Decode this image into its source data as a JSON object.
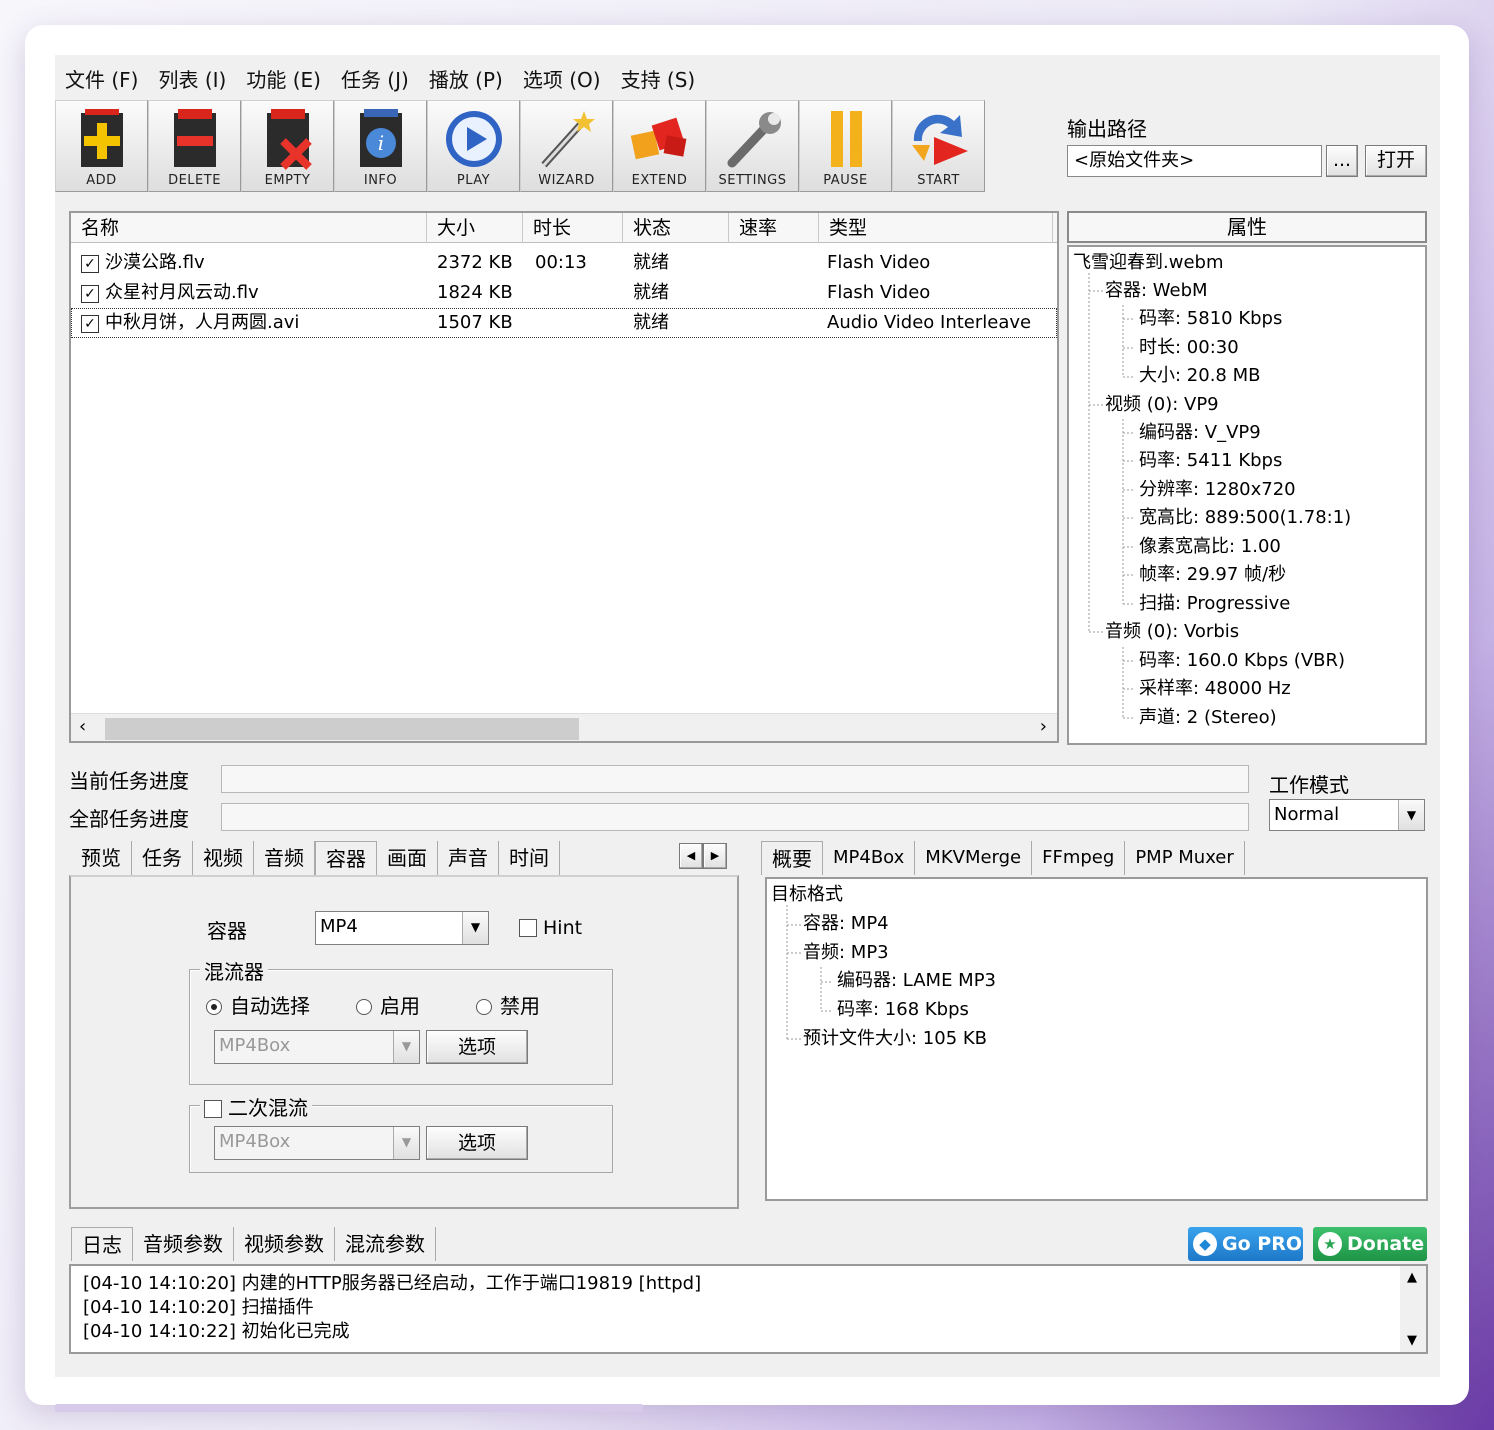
{
  "menu": [
    "文件 (F)",
    "列表 (I)",
    "功能 (E)",
    "任务 (J)",
    "播放 (P)",
    "选项 (O)",
    "支持 (S)"
  ],
  "toolbar": {
    "buttons": [
      {
        "label": "ADD",
        "icon": "add-icon"
      },
      {
        "label": "DELETE",
        "icon": "delete-icon"
      },
      {
        "label": "EMPTY",
        "icon": "empty-icon"
      },
      {
        "label": "INFO",
        "icon": "info-icon"
      },
      {
        "label": "PLAY",
        "icon": "play-icon"
      },
      {
        "label": "WIZARD",
        "icon": "wizard-icon"
      },
      {
        "label": "EXTEND",
        "icon": "extend-icon"
      },
      {
        "label": "SETTINGS",
        "icon": "settings-icon"
      },
      {
        "label": "PAUSE",
        "icon": "pause-icon"
      },
      {
        "label": "START",
        "icon": "start-icon"
      }
    ]
  },
  "output": {
    "label": "输出路径",
    "value": "<原始文件夹>",
    "browse": "...",
    "open": "打开"
  },
  "file_list": {
    "columns": [
      "名称",
      "大小",
      "时长",
      "状态",
      "速率",
      "类型"
    ],
    "rows": [
      {
        "checked": true,
        "name": "沙漠公路.flv",
        "size": "2372 KB",
        "duration": "00:13",
        "status": "就绪",
        "rate": "",
        "type": "Flash Video"
      },
      {
        "checked": true,
        "name": "众星衬月风云动.flv",
        "size": "1824 KB",
        "duration": "",
        "status": "就绪",
        "rate": "",
        "type": "Flash Video"
      },
      {
        "checked": true,
        "name": "中秋月饼，人月两圆.avi",
        "size": "1507 KB",
        "duration": "",
        "status": "就绪",
        "rate": "",
        "type": "Audio Video Interleave"
      }
    ]
  },
  "properties": {
    "header": "属性",
    "tree": [
      {
        "text": "飞雪迎春到.webm",
        "level": 0
      },
      {
        "text": "容器: WebM",
        "level": 1
      },
      {
        "text": "码率: 5810 Kbps",
        "level": 2
      },
      {
        "text": "时长: 00:30",
        "level": 2
      },
      {
        "text": "大小: 20.8 MB",
        "level": 2
      },
      {
        "text": "视频 (0): VP9",
        "level": 1
      },
      {
        "text": "编码器: V_VP9",
        "level": 2
      },
      {
        "text": "码率: 5411 Kbps",
        "level": 2
      },
      {
        "text": "分辨率: 1280x720",
        "level": 2
      },
      {
        "text": "宽高比: 889:500(1.78:1)",
        "level": 2
      },
      {
        "text": "像素宽高比: 1.00",
        "level": 2
      },
      {
        "text": "帧率: 29.97 帧/秒",
        "level": 2
      },
      {
        "text": "扫描: Progressive",
        "level": 2
      },
      {
        "text": "音频 (0): Vorbis",
        "level": 1
      },
      {
        "text": "码率: 160.0 Kbps (VBR)",
        "level": 2
      },
      {
        "text": "采样率: 48000 Hz",
        "level": 2
      },
      {
        "text": "声道: 2 (Stereo)",
        "level": 2
      }
    ]
  },
  "progress": {
    "current_label": "当前任务进度",
    "total_label": "全部任务进度",
    "current_value": 0,
    "total_value": 0
  },
  "work_mode": {
    "label": "工作模式",
    "value": "Normal"
  },
  "left_tabs": [
    "预览",
    "任务",
    "视频",
    "音频",
    "容器",
    "画面",
    "声音",
    "时间"
  ],
  "container_panel": {
    "container_label": "容器",
    "container_value": "MP4",
    "hint_label": "Hint",
    "muxer_legend": "混流器",
    "radio_auto": "自动选择",
    "radio_enable": "启用",
    "radio_disable": "禁用",
    "muxer_value": "MP4Box",
    "options_label": "选项",
    "remux_legend": "二次混流",
    "remux_value": "MP4Box",
    "remux_options_label": "选项"
  },
  "right_tabs": [
    "概要",
    "MP4Box",
    "MKVMerge",
    "FFmpeg",
    "PMP Muxer"
  ],
  "summary_tree": [
    {
      "text": "目标格式",
      "level": 0
    },
    {
      "text": "容器: MP4",
      "level": 1
    },
    {
      "text": "音频: MP3",
      "level": 1
    },
    {
      "text": "编码器: LAME MP3",
      "level": 2
    },
    {
      "text": "码率: 168 Kbps",
      "level": 2
    },
    {
      "text": "预计文件大小: 105 KB",
      "level": 1
    }
  ],
  "bottom_tabs": [
    "日志",
    "音频参数",
    "视频参数",
    "混流参数"
  ],
  "badges": {
    "gopro": "Go PRO",
    "donate": "Donate"
  },
  "log": [
    "[04-10 14:10:20] 内建的HTTP服务器已经启动，工作于端口19819 [httpd]",
    "[04-10 14:10:20] 扫描插件",
    "[04-10 14:10:22] 初始化已完成"
  ],
  "colors": {
    "gopro": "#1d88d8",
    "donate": "#27a552"
  }
}
